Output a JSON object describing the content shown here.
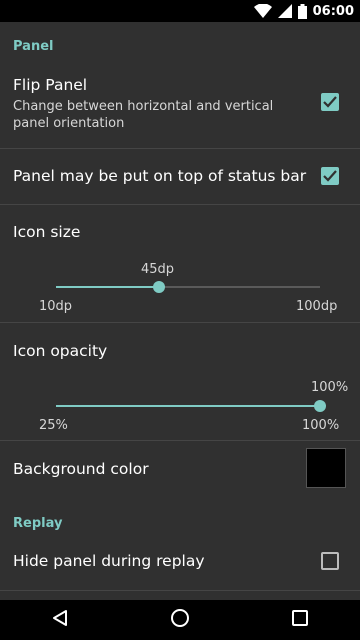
{
  "status_bar": {
    "time": "06:00",
    "icons": [
      "wifi-icon",
      "signal-icon",
      "battery-icon"
    ]
  },
  "sections": {
    "panel": {
      "header": "Panel"
    },
    "replay": {
      "header": "Replay"
    }
  },
  "flip_panel": {
    "title": "Flip Panel",
    "subtitle": "Change between horizontal and vertical panel orientation",
    "checked": true
  },
  "on_top_status_bar": {
    "title": "Panel may be put on top of status bar",
    "checked": true
  },
  "icon_size": {
    "title": "Icon size",
    "value_label": "45dp",
    "value": 45,
    "min": 10,
    "max": 100,
    "min_label": "10dp",
    "max_label": "100dp"
  },
  "icon_opacity": {
    "title": "Icon opacity",
    "value_label": "100%",
    "value": 100,
    "min": 25,
    "max": 100,
    "min_label": "25%",
    "max_label": "100%"
  },
  "background_color": {
    "title": "Background color",
    "color": "#000000"
  },
  "hide_panel_replay": {
    "title": "Hide panel during replay",
    "checked": false
  },
  "nav": {
    "icons": [
      "back-icon",
      "home-icon",
      "recents-icon"
    ]
  },
  "colors": {
    "accent": "#7fcbc4",
    "background": "#303030"
  }
}
